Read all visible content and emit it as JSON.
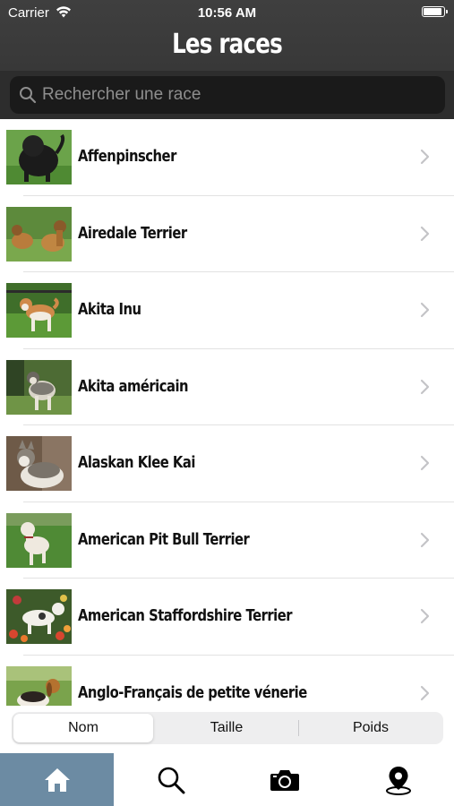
{
  "status_bar": {
    "carrier": "Carrier",
    "time": "10:56 AM",
    "battery_level": 1.0
  },
  "nav": {
    "title": "Les races"
  },
  "search": {
    "placeholder": "Rechercher une race",
    "value": ""
  },
  "breeds": [
    {
      "name": "Affenpinscher",
      "photo": "black-dog-on-grass"
    },
    {
      "name": "Airedale Terrier",
      "photo": "tan-dogs-on-grass"
    },
    {
      "name": "Akita Inu",
      "photo": "red-white-dog-on-lawn"
    },
    {
      "name": "Akita américain",
      "photo": "grey-dog-on-grass"
    },
    {
      "name": "Alaskan Klee Kai",
      "photo": "husky-like-dog-indoors"
    },
    {
      "name": "American Pit Bull Terrier",
      "photo": "white-dog-on-grass"
    },
    {
      "name": "American Staffordshire Terrier",
      "photo": "white-dog-in-flowers"
    },
    {
      "name": "Anglo-Français de petite vénerie",
      "photo": "hound-on-grass"
    }
  ],
  "sort_control": {
    "options": [
      "Nom",
      "Taille",
      "Poids"
    ],
    "selected": "Nom"
  },
  "tab_bar": {
    "tabs": [
      {
        "icon": "home-icon",
        "active": true
      },
      {
        "icon": "search-icon",
        "active": false
      },
      {
        "icon": "camera-icon",
        "active": false
      },
      {
        "icon": "map-pin-icon",
        "active": false
      }
    ],
    "active_color": "#6c8ba3"
  },
  "colors": {
    "header": "#3a3a3a",
    "search_field": "#1a1a1a"
  }
}
